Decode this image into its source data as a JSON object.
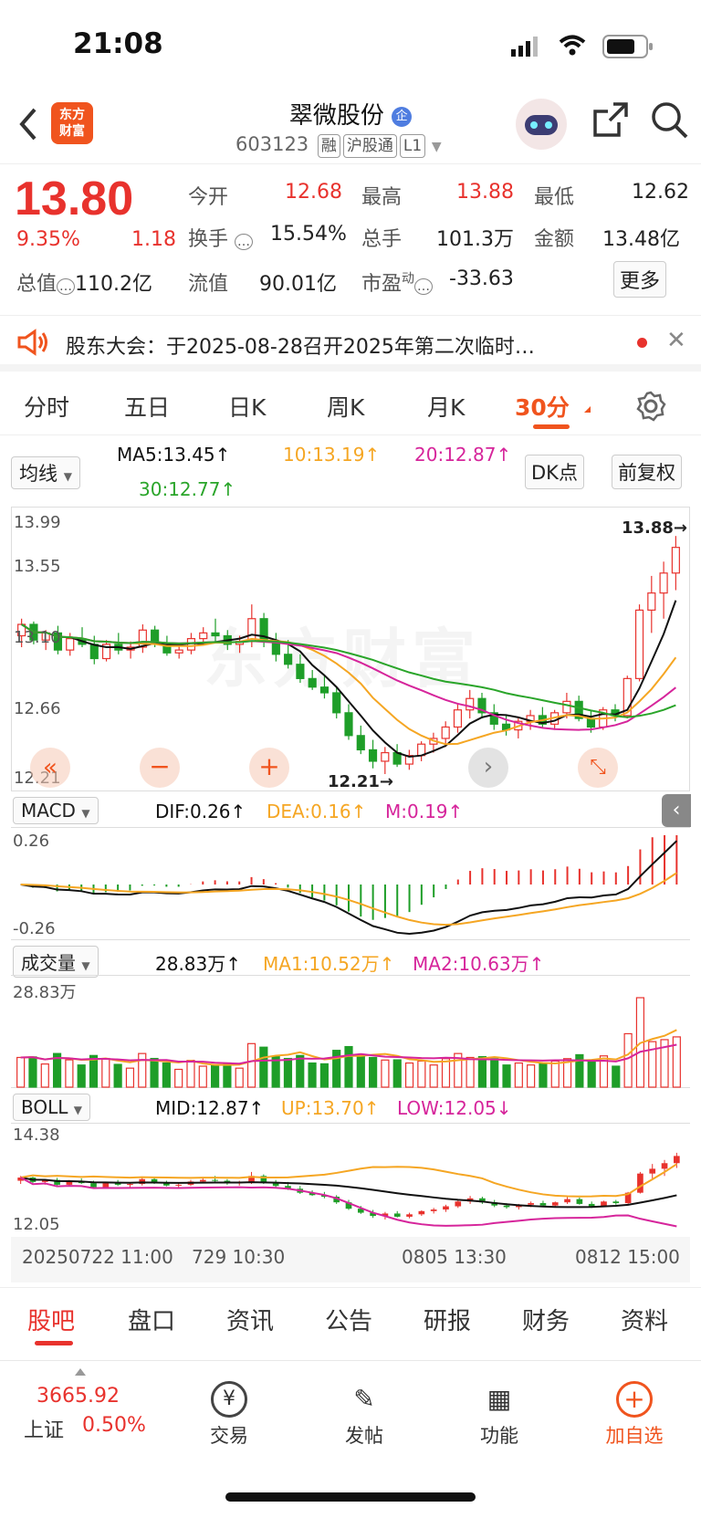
{
  "status_bar": {
    "time": "21:08"
  },
  "header": {
    "logo_text": "东方\n财富",
    "name": "翠微股份",
    "name_badge": "企",
    "code": "603123",
    "tags": [
      "融",
      "沪股通",
      "L1"
    ]
  },
  "quote": {
    "price": "13.80",
    "change_pct": "9.35%",
    "change": "1.18",
    "open_label": "今开",
    "open": "12.68",
    "high_label": "最高",
    "high": "13.88",
    "low_label": "最低",
    "low": "12.62",
    "turnover_label": "换手",
    "turnover": "15.54%",
    "volume_label": "总手",
    "volume": "101.3万",
    "amount_label": "金额",
    "amount": "13.48亿",
    "mktcap_label": "总值",
    "mktcap": "110.2亿",
    "float_label": "流值",
    "float": "90.01亿",
    "pe_label": "市盈",
    "pe_sup": "动",
    "pe": "-33.63",
    "more": "更多"
  },
  "notice": {
    "text": "股东大会：于2025-08-28召开2025年第二次临时…"
  },
  "period_tabs": [
    "分时",
    "五日",
    "日K",
    "周K",
    "月K",
    "30分"
  ],
  "active_period": "30分",
  "ma_row": {
    "selector": "均线",
    "ma5": "MA5:13.45↑",
    "ma10": "10:13.19↑",
    "ma20": "20:12.87↑",
    "ma30": "30:12.77↑",
    "dk_button": "DK点",
    "adj_button": "前复权"
  },
  "colors": {
    "up": "#e8322d",
    "down": "#1e9e28",
    "ma5": "#111111",
    "ma10": "#f5a623",
    "ma20": "#d6259b",
    "ma30": "#2aa52a",
    "accent": "#f0541e"
  },
  "main_chart": {
    "y_ticks": [
      "13.99",
      "13.55",
      "13.10",
      "12.66",
      "12.21"
    ],
    "max_marker": "13.88→",
    "min_marker": "12.21→",
    "watermark": "东方财富"
  },
  "macd": {
    "selector": "MACD",
    "dif": "DIF:0.26↑",
    "dea": "DEA:0.16↑",
    "m": "M:0.19↑",
    "y_top": "0.26",
    "y_bottom": "-0.26"
  },
  "volume": {
    "selector": "成交量",
    "value": "28.83万↑",
    "ma1": "MA1:10.52万↑",
    "ma2": "MA2:10.63万↑",
    "y_top": "28.83万"
  },
  "boll": {
    "selector": "BOLL",
    "mid": "MID:12.87↑",
    "up": "UP:13.70↑",
    "low": "LOW:12.05↓",
    "y_top": "14.38",
    "y_bottom": "12.05"
  },
  "time_axis": [
    "20250722 11:00",
    "729 10:30",
    "0805 13:30",
    "0812 15:00"
  ],
  "bottom_tabs": [
    "股吧",
    "盘口",
    "资讯",
    "公告",
    "研报",
    "财务",
    "资料"
  ],
  "footer": {
    "index_value": "3665.92",
    "index_name": "上证",
    "index_pct": "0.50%",
    "items": [
      "交易",
      "发帖",
      "功能",
      "加自选"
    ]
  },
  "chart_data": {
    "type": "candlestick",
    "candles": [
      [
        13.18,
        13.3,
        13.1,
        13.26
      ],
      [
        13.26,
        13.28,
        13.12,
        13.15
      ],
      [
        13.15,
        13.22,
        13.08,
        13.2
      ],
      [
        13.2,
        13.25,
        13.05,
        13.08
      ],
      [
        13.08,
        13.2,
        13.04,
        13.16
      ],
      [
        13.16,
        13.24,
        13.1,
        13.12
      ],
      [
        13.12,
        13.18,
        12.98,
        13.02
      ],
      [
        13.02,
        13.15,
        13.0,
        13.12
      ],
      [
        13.12,
        13.2,
        13.05,
        13.08
      ],
      [
        13.08,
        13.14,
        13.02,
        13.1
      ],
      [
        13.1,
        13.26,
        13.06,
        13.22
      ],
      [
        13.22,
        13.25,
        13.1,
        13.12
      ],
      [
        13.12,
        13.18,
        13.04,
        13.06
      ],
      [
        13.06,
        13.12,
        13.02,
        13.08
      ],
      [
        13.08,
        13.2,
        13.05,
        13.16
      ],
      [
        13.16,
        13.24,
        13.12,
        13.2
      ],
      [
        13.2,
        13.3,
        13.14,
        13.18
      ],
      [
        13.18,
        13.22,
        13.08,
        13.12
      ],
      [
        13.12,
        13.18,
        13.06,
        13.14
      ],
      [
        13.14,
        13.4,
        13.1,
        13.3
      ],
      [
        13.3,
        13.34,
        13.1,
        13.14
      ],
      [
        13.14,
        13.2,
        13.0,
        13.05
      ],
      [
        13.05,
        13.15,
        12.95,
        12.98
      ],
      [
        12.98,
        13.05,
        12.85,
        12.88
      ],
      [
        12.88,
        12.94,
        12.8,
        12.82
      ],
      [
        12.82,
        12.9,
        12.74,
        12.78
      ],
      [
        12.78,
        12.82,
        12.6,
        12.64
      ],
      [
        12.64,
        12.7,
        12.45,
        12.48
      ],
      [
        12.48,
        12.55,
        12.35,
        12.38
      ],
      [
        12.38,
        12.45,
        12.25,
        12.3
      ],
      [
        12.3,
        12.4,
        12.21,
        12.36
      ],
      [
        12.36,
        12.42,
        12.26,
        12.28
      ],
      [
        12.28,
        12.38,
        12.24,
        12.34
      ],
      [
        12.34,
        12.44,
        12.3,
        12.42
      ],
      [
        12.42,
        12.5,
        12.36,
        12.46
      ],
      [
        12.46,
        12.58,
        12.4,
        12.54
      ],
      [
        12.54,
        12.7,
        12.5,
        12.66
      ],
      [
        12.66,
        12.8,
        12.6,
        12.74
      ],
      [
        12.74,
        12.78,
        12.6,
        12.64
      ],
      [
        12.64,
        12.7,
        12.52,
        12.56
      ],
      [
        12.56,
        12.62,
        12.48,
        12.52
      ],
      [
        12.52,
        12.6,
        12.46,
        12.58
      ],
      [
        12.58,
        12.66,
        12.52,
        12.62
      ],
      [
        12.62,
        12.68,
        12.54,
        12.56
      ],
      [
        12.56,
        12.66,
        12.52,
        12.64
      ],
      [
        12.64,
        12.78,
        12.6,
        12.72
      ],
      [
        12.72,
        12.76,
        12.58,
        12.6
      ],
      [
        12.6,
        12.66,
        12.5,
        12.54
      ],
      [
        12.54,
        12.68,
        12.52,
        12.66
      ],
      [
        12.66,
        12.7,
        12.58,
        12.62
      ],
      [
        12.62,
        12.9,
        12.6,
        12.88
      ],
      [
        12.88,
        13.4,
        12.86,
        13.36
      ],
      [
        13.36,
        13.6,
        13.2,
        13.48
      ],
      [
        13.48,
        13.7,
        13.3,
        13.62
      ],
      [
        13.62,
        13.88,
        13.5,
        13.8
      ]
    ],
    "y_range": [
      12.21,
      13.99
    ]
  }
}
